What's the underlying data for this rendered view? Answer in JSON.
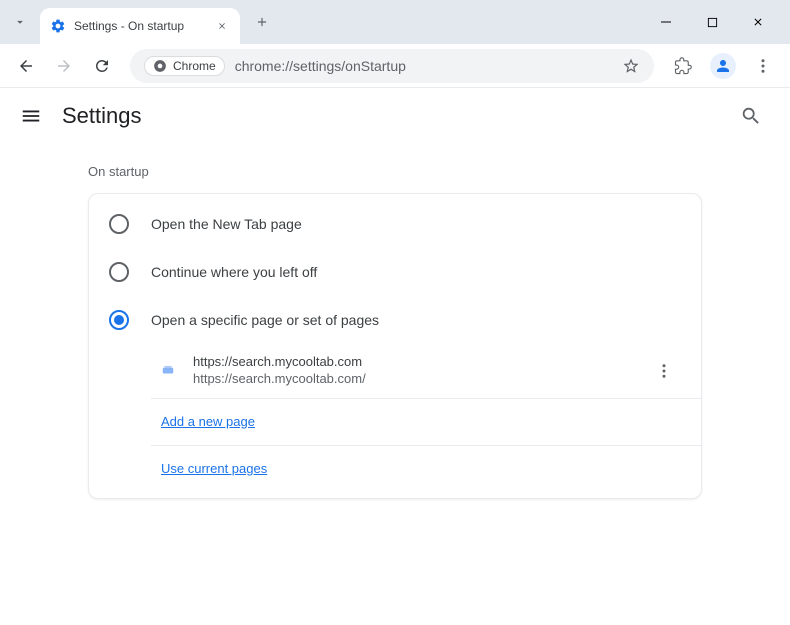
{
  "window": {
    "tab_title": "Settings - On startup"
  },
  "toolbar": {
    "chrome_chip": "Chrome",
    "url": "chrome://settings/onStartup"
  },
  "header": {
    "title": "Settings"
  },
  "section": {
    "label": "On startup"
  },
  "options": {
    "new_tab": "Open the New Tab page",
    "continue": "Continue where you left off",
    "specific": "Open a specific page or set of pages"
  },
  "startup_page": {
    "name": "https://search.mycooltab.com",
    "url": "https://search.mycooltab.com/"
  },
  "links": {
    "add_page": "Add a new page",
    "use_current": "Use current pages"
  }
}
